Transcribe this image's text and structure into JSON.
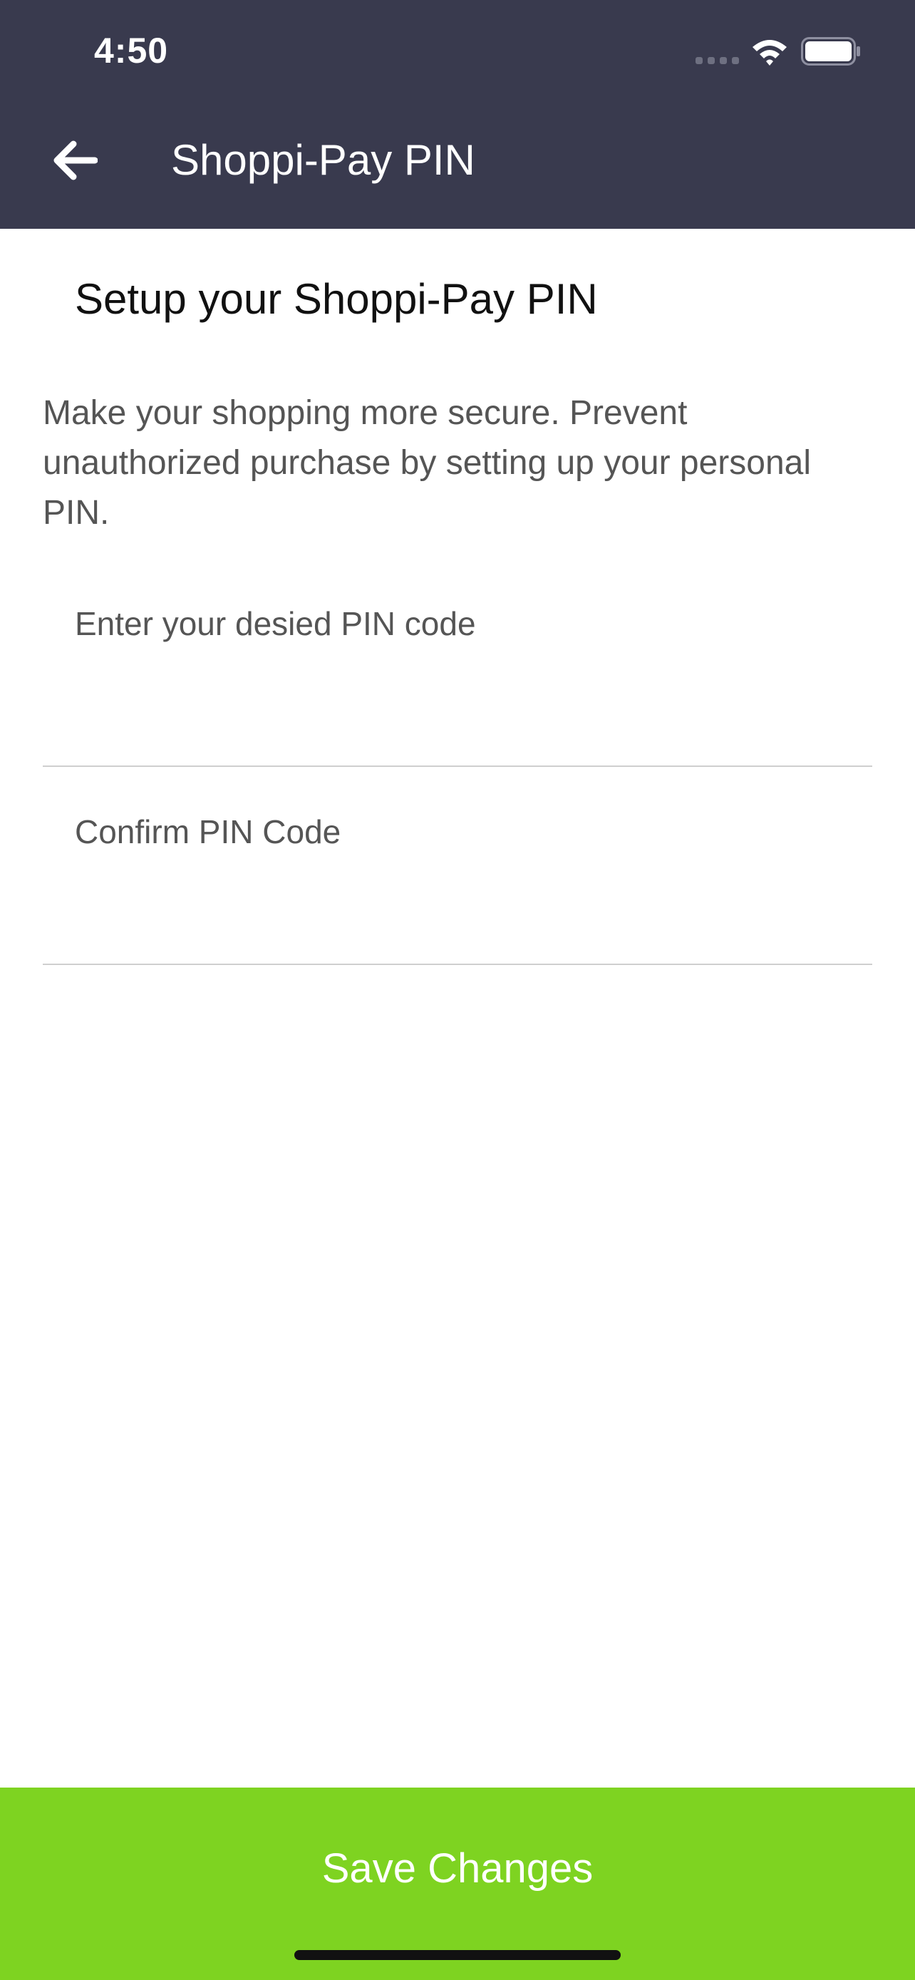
{
  "status_bar": {
    "time": "4:50"
  },
  "header": {
    "title": "Shoppi-Pay PIN",
    "back_icon": "arrow-left-icon",
    "background_color": "#393a4e"
  },
  "main": {
    "section_title": "Setup your Shoppi-Pay PIN",
    "description": "Make your shopping more secure. Prevent unauthorized purchase by setting up your personal PIN.",
    "fields": [
      {
        "label": "Enter your desied PIN code",
        "value": ""
      },
      {
        "label": "Confirm PIN Code",
        "value": ""
      }
    ]
  },
  "footer": {
    "save_label": "Save Changes",
    "accent_color": "#7ed321"
  }
}
